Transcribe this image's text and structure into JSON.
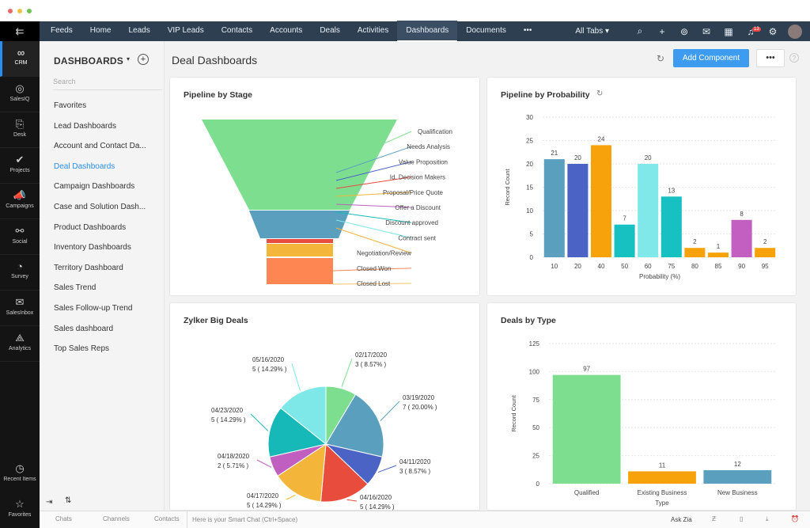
{
  "nav": {
    "tabs": [
      "Feeds",
      "Home",
      "Leads",
      "VIP Leads",
      "Contacts",
      "Accounts",
      "Deals",
      "Activities",
      "Dashboards",
      "Documents",
      "•••"
    ],
    "active": "Dashboards",
    "all_tabs": "All Tabs ▾",
    "notification_count": "13"
  },
  "rail": [
    "CRM",
    "SalesIQ",
    "Desk",
    "Projects",
    "Campaigns",
    "Social",
    "Survey",
    "SalesInbox",
    "Analytics"
  ],
  "rail_bottom": [
    "Recent Items",
    "Favorites"
  ],
  "sidebar": {
    "title": "DASHBOARDS",
    "search_placeholder": "Search",
    "items": [
      "Favorites",
      "Lead Dashboards",
      "Account and Contact Da...",
      "Deal Dashboards",
      "Campaign Dashboards",
      "Case and Solution Dash...",
      "Product Dashboards",
      "Inventory Dashboards",
      "Territory Dashboard",
      "Sales Trend",
      "Sales Follow-up Trend",
      "Sales dashboard",
      "Top Sales Reps"
    ],
    "active": "Deal Dashboards"
  },
  "header": {
    "title": "Deal Dashboards",
    "add_component": "Add Component",
    "more": "•••"
  },
  "bottom": {
    "chats": "Chats",
    "channels": "Channels",
    "contacts": "Contacts",
    "smart_chat": "Here is your Smart Chat (Ctrl+Space)",
    "ask_zia": "Ask Zia"
  },
  "chart_data": [
    {
      "type": "funnel",
      "title": "Pipeline by Stage",
      "stages": [
        "Qualification",
        "Needs Analysis",
        "Value Proposition",
        "Id. Decision Makers",
        "Proposal/Price Quote",
        "Offer a Discount",
        "Discount approved",
        "Contract sent",
        "Negotiation/Review",
        "Closed Won",
        "Closed Lost"
      ],
      "colors": [
        "#7ede8f",
        "#5b9fbf",
        "#4a63c4",
        "#e84c3d",
        "#f3b63a",
        "#c05fc0",
        "#17b8b8",
        "#7ee8e8",
        "#f3b63a",
        "#fd8653",
        "#f7c26b"
      ]
    },
    {
      "type": "bar",
      "title": "Pipeline by Probability",
      "categories": [
        "10",
        "20",
        "40",
        "50",
        "60",
        "75",
        "80",
        "85",
        "90",
        "95"
      ],
      "values": [
        21,
        20,
        24,
        7,
        20,
        13,
        2,
        1,
        8,
        2
      ],
      "colors": [
        "#5b9fbf",
        "#4a63c4",
        "#f7a20a",
        "#18c1c1",
        "#80e8e8",
        "#18c1c1",
        "#f7a20a",
        "#f7a20a",
        "#c25fc0",
        "#f7a20a"
      ],
      "xlabel": "Probability (%)",
      "ylabel": "Record Count",
      "ylim": [
        0,
        30
      ],
      "yticks": [
        0,
        5,
        10,
        15,
        20,
        25,
        30
      ],
      "grid": true
    },
    {
      "type": "pie",
      "title": "Zylker Big Deals",
      "slices": [
        {
          "label": "02/17/2020",
          "value": 3,
          "pct": "3 ( 8.57% )",
          "color": "#7ede8f"
        },
        {
          "label": "03/19/2020",
          "value": 7,
          "pct": "7 ( 20.00% )",
          "color": "#5b9fbf"
        },
        {
          "label": "04/11/2020",
          "value": 3,
          "pct": "3 ( 8.57% )",
          "color": "#4a63c4"
        },
        {
          "label": "04/16/2020",
          "value": 5,
          "pct": "5 ( 14.29% )",
          "color": "#e84c3d"
        },
        {
          "label": "04/17/2020",
          "value": 5,
          "pct": "5 ( 14.29% )",
          "color": "#f3b63a"
        },
        {
          "label": "04/18/2020",
          "value": 2,
          "pct": "2 ( 5.71% )",
          "color": "#c05fc0"
        },
        {
          "label": "04/23/2020",
          "value": 5,
          "pct": "5 ( 14.29% )",
          "color": "#17b8b8"
        },
        {
          "label": "05/16/2020",
          "value": 5,
          "pct": "5 ( 14.29% )",
          "color": "#7ee8e8"
        }
      ]
    },
    {
      "type": "bar",
      "title": "Deals by Type",
      "categories": [
        "Qualified",
        "Existing Business",
        "New Business"
      ],
      "values": [
        97,
        11,
        12
      ],
      "colors": [
        "#7ede8f",
        "#f7a20a",
        "#5b9fbf"
      ],
      "xlabel": "Type",
      "ylabel": "Record Count",
      "ylim": [
        0,
        125
      ],
      "yticks": [
        0,
        25,
        50,
        75,
        100,
        125
      ],
      "grid": true
    }
  ]
}
